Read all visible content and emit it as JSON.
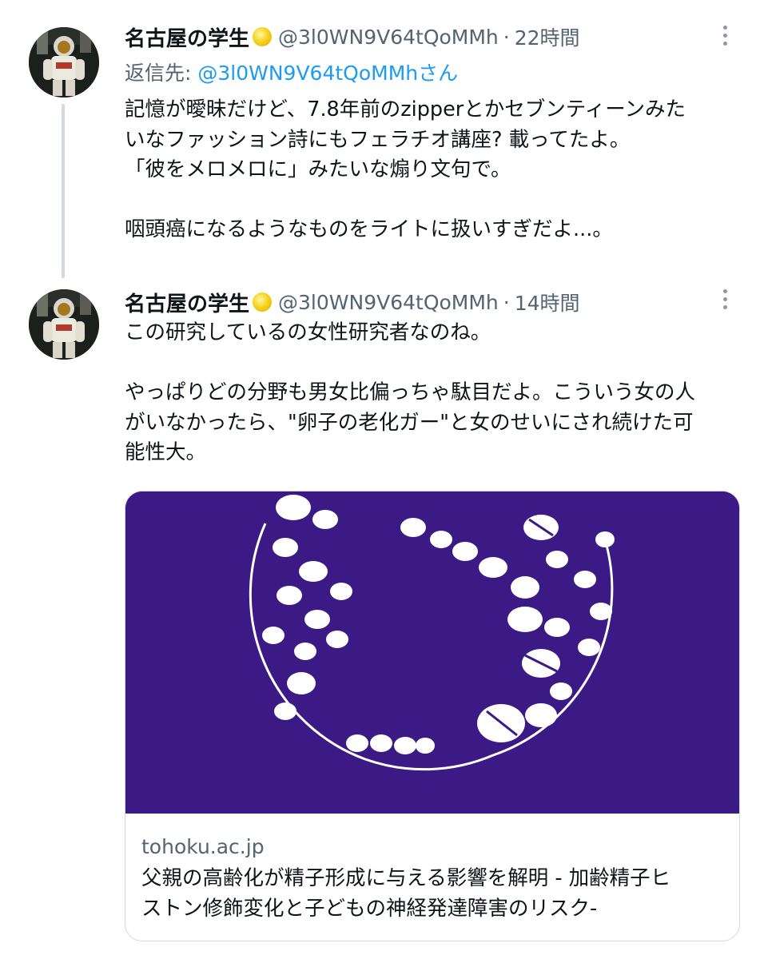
{
  "tweets": [
    {
      "display_name": "名古屋の学生",
      "handle": "@3l0WN9V64tQoMMh",
      "separator": "·",
      "time": "22時間",
      "reply_prefix": "返信先: ",
      "reply_to": "@3l0WN9V64tQoMMhさん",
      "lines": [
        "記憶が曖昧だけど、7.8年前のzipperとかセブンティーンみた",
        "いなファッション詩にもフェラチオ講座? 載ってたよ。",
        "「彼をメロメロに」みたいな煽り文句で。",
        "",
        "咽頭癌になるようなものをライトに扱いすぎだよ...。"
      ]
    },
    {
      "display_name": "名古屋の学生",
      "handle": "@3l0WN9V64tQoMMh",
      "separator": "·",
      "time": "14時間",
      "lines": [
        "この研究しているの女性研究者なのね。",
        "",
        "やっぱりどの分野も男女比偏っちゃ駄目だよ。こういう女の人",
        "がいなかったら、\"卵子の老化ガー\"と女のせいにされ続けた可",
        "能性大。"
      ],
      "card": {
        "domain": "tohoku.ac.jp",
        "title_lines": [
          "父親の高齢化が精子形成に与える影響を解明 - 加齢精子ヒ",
          "ストン修飾変化と子どもの神経発達障害のリスク-"
        ],
        "image_bg_color": "#3c1a86"
      }
    }
  ],
  "colors": {
    "text": "#0f1419",
    "secondary": "#536471",
    "link": "#1d9bf0",
    "thread_line": "#cfd9de"
  },
  "icons": {
    "badge": "verified-gold-circle-icon",
    "more": "more-options-icon"
  }
}
